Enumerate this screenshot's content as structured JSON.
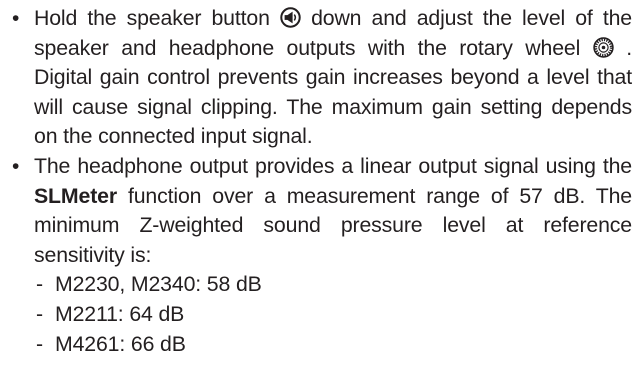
{
  "bullets": [
    {
      "part_1": "Hold the speaker button",
      "part_2": "down and adjust the level of the speaker and headphone outputs with the rotary wheel",
      "part_3": ". Digital gain control prevents gain increases be­yond a level that will cause signal clipping. The maximum gain setting depends on the connected input signal.",
      "icons": [
        "speaker-button-icon",
        "rotary-wheel-icon"
      ]
    },
    {
      "part_1": "The headphone output provides a linear output signal us­ing the ",
      "bold": "SLMeter",
      "part_2": " function over a measurement range of 57 dB. The minimum Z-weighted sound pressure level at reference sensitivity is:",
      "sub_items": [
        "M2230, M2340: 58 dB",
        "M2211: 64 dB",
        "M4261: 66 dB"
      ]
    }
  ],
  "bullet_glyph": "•",
  "sub_glyph": "-",
  "colors": {
    "text": "#231f20"
  }
}
